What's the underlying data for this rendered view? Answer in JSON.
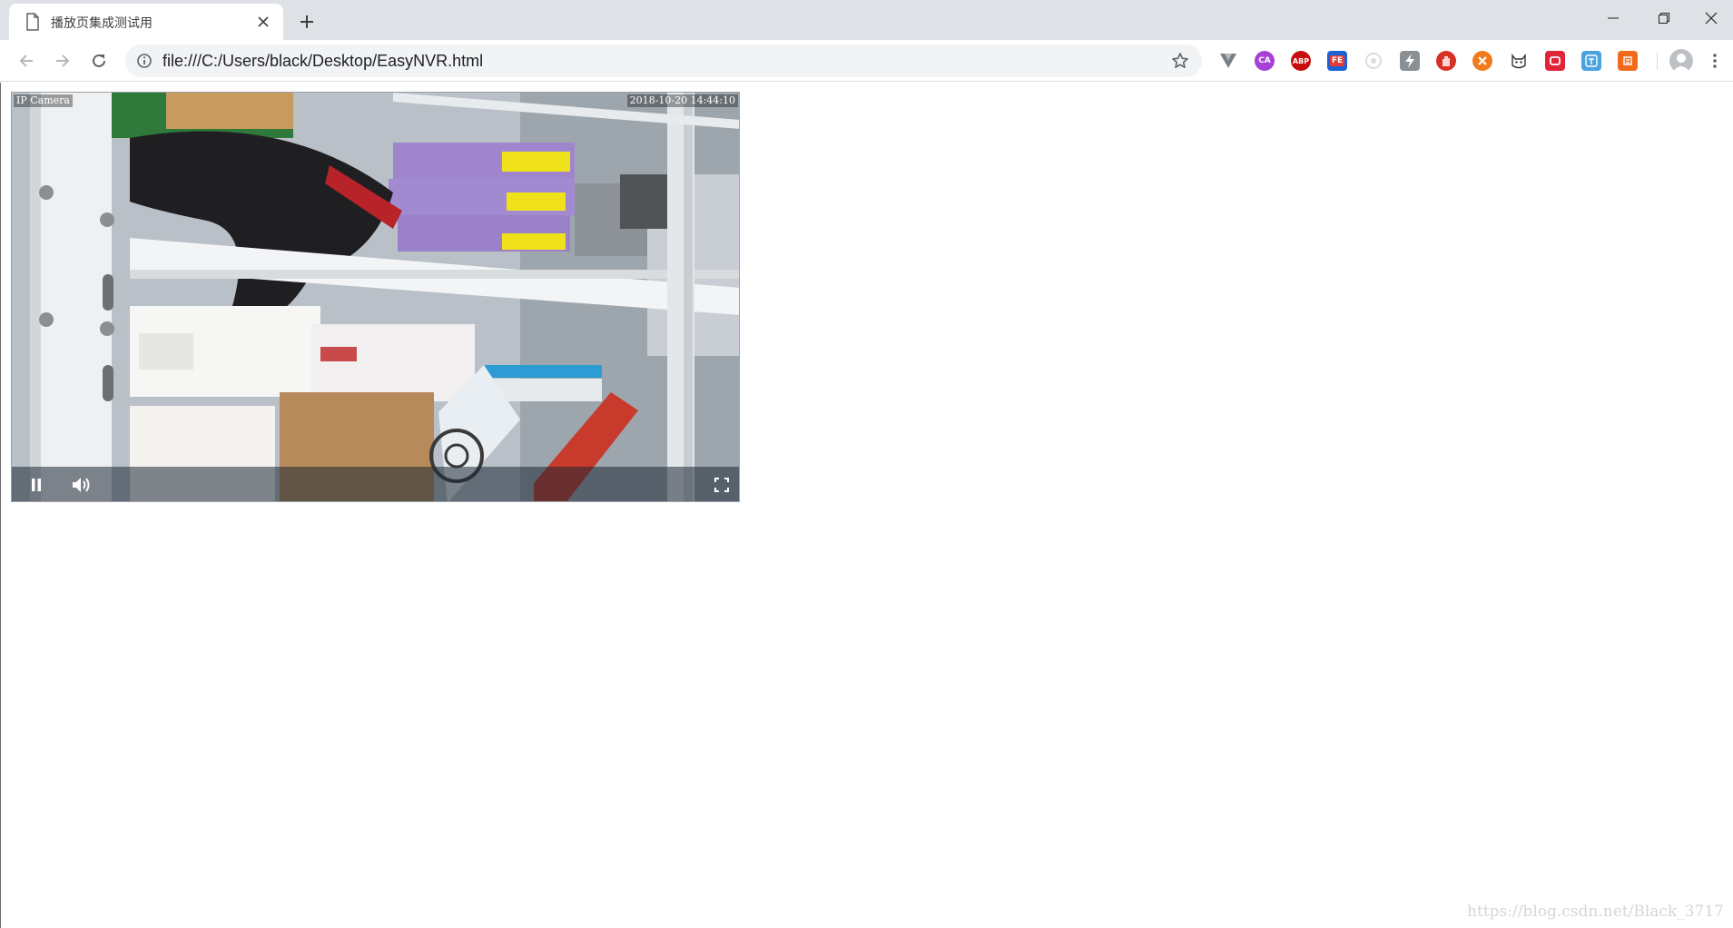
{
  "tab": {
    "title": "播放页集成测试用"
  },
  "address_bar": {
    "url": "file:///C:/Users/black/Desktop/EasyNVR.html"
  },
  "extensions": [
    {
      "name": "vimium-icon",
      "label": "",
      "color": "#7a7f85"
    },
    {
      "name": "ca-extension-icon",
      "label": "CA",
      "color": "#a640d6"
    },
    {
      "name": "adblock-plus-icon",
      "label": "ABP",
      "color": "#c70d0d"
    },
    {
      "name": "fe-helper-icon",
      "label": "FE",
      "color": "#e53935"
    },
    {
      "name": "grey-circle-extension-icon",
      "label": "",
      "color": "#dadce0"
    },
    {
      "name": "lightning-extension-icon",
      "label": "",
      "color": "#8a8f94"
    },
    {
      "name": "stop-hand-extension-icon",
      "label": "",
      "color": "#d93025"
    },
    {
      "name": "orange-x-extension-icon",
      "label": "",
      "color": "#f07b1e"
    },
    {
      "name": "cat-extension-icon",
      "label": "",
      "color": "#444444"
    },
    {
      "name": "red-square-extension-icon",
      "label": "",
      "color": "#e0243a"
    },
    {
      "name": "translate-extension-icon",
      "label": "",
      "color": "#4aa3df"
    },
    {
      "name": "orange-square-extension-icon",
      "label": "",
      "color": "#f26b1d"
    }
  ],
  "player": {
    "osd_camera": "IP Camera",
    "osd_timestamp": "2018-10-20 14:44:10",
    "state": "playing"
  },
  "watermark": "https://blog.csdn.net/Black_3717"
}
